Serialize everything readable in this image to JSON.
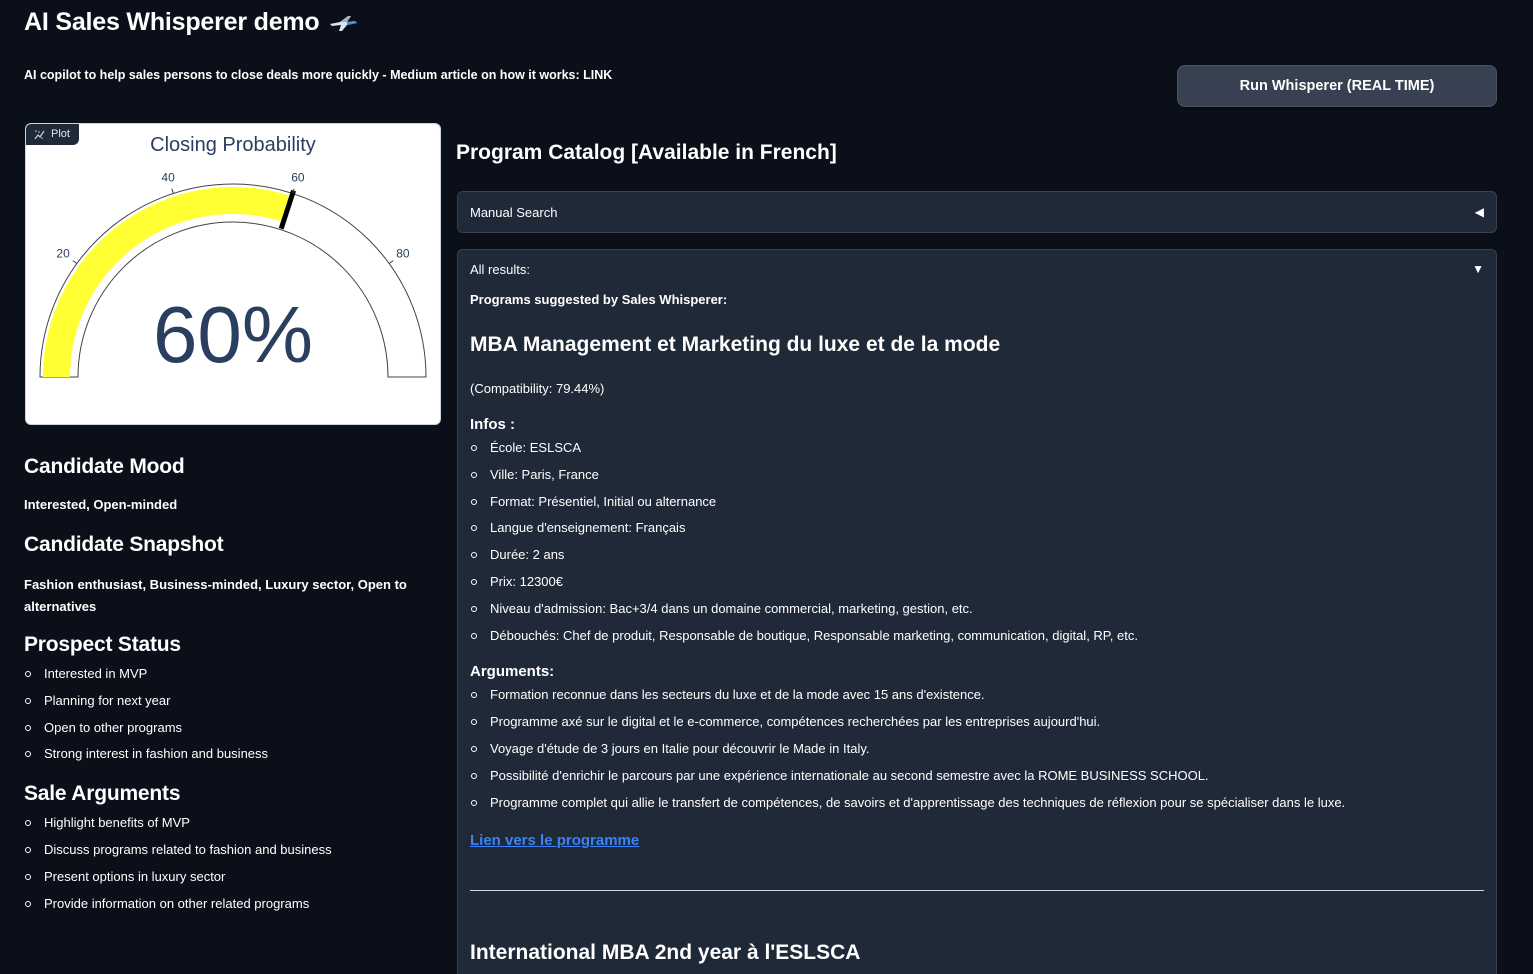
{
  "header": {
    "title": "AI Sales Whisperer demo",
    "title_icon": "airplane-icon",
    "subtitle": "AI copilot to help sales persons to close deals more quickly - Medium article on how it works: LINK",
    "run_button_label": "Run Whisperer (REAL TIME)"
  },
  "plot": {
    "badge_label": "Plot",
    "chart_data": {
      "type": "gauge",
      "title": "Closing Probability",
      "value": 60,
      "value_display": "60%",
      "range": [
        0,
        100
      ],
      "ticks": [
        "20",
        "40",
        "60",
        "80"
      ],
      "tick_values": [
        20,
        40,
        60,
        80
      ],
      "bar_color": "#ffff33",
      "threshold_color": "#000000",
      "threshold_value": 60
    }
  },
  "candidate": {
    "mood_heading": "Candidate Mood",
    "mood_text": "Interested, Open-minded",
    "snapshot_heading": "Candidate Snapshot",
    "snapshot_text": "Fashion enthusiast, Business-minded, Luxury sector, Open to alternatives",
    "prospect_heading": "Prospect Status",
    "prospect_items": [
      "Interested in MVP",
      "Planning for next year",
      "Open to other programs",
      "Strong interest in fashion and business"
    ],
    "arguments_heading": "Sale Arguments",
    "arguments_items": [
      "Highlight benefits of MVP",
      "Discuss programs related to fashion and business",
      "Present options in luxury sector",
      "Provide information on other related programs"
    ]
  },
  "catalog": {
    "title": "Program Catalog [Available in French]",
    "manual_search_label": "Manual Search",
    "manual_search_arrow": "◀",
    "all_results_label": "All results:",
    "all_results_arrow": "▼",
    "suggested_label": "Programs suggested by Sales Whisperer:",
    "programs": [
      {
        "title": "MBA Management et Marketing du luxe et de la mode",
        "compatibility": "(Compatibility: 79.44%)",
        "infos_heading": "Infos :",
        "infos": [
          "École: ESLSCA",
          "Ville: Paris, France",
          "Format: Présentiel, Initial ou alternance",
          "Langue d'enseignement: Français",
          "Durée: 2 ans",
          "Prix: 12300€",
          "Niveau d'admission: Bac+3/4 dans un domaine commercial, marketing, gestion, etc.",
          "Débouchés: Chef de produit, Responsable de boutique, Responsable marketing, communication, digital, RP, etc."
        ],
        "arguments_heading": "Arguments:",
        "arguments": [
          "Formation reconnue dans les secteurs du luxe et de la mode avec 15 ans d'existence.",
          "Programme axé sur le digital et le e-commerce, compétences recherchées par les entreprises aujourd'hui.",
          "Voyage d'étude de 3 jours en Italie pour découvrir le Made in Italy.",
          "Possibilité d'enrichir le parcours par une expérience internationale au second semestre avec la ROME BUSINESS SCHOOL.",
          "Programme complet qui allie le transfert de compétences, de savoirs et d'apprentissage des techniques de réflexion pour se spécialiser dans le luxe."
        ],
        "link_label": "Lien vers le programme"
      },
      {
        "title": "International MBA 2nd year à l'ESLSCA"
      }
    ]
  },
  "colors": {
    "background": "#0b0f19",
    "panel": "#1f2937",
    "link": "#3b82f6",
    "gauge_bar": "#ffff33",
    "gauge_text": "#2a3f5f"
  }
}
